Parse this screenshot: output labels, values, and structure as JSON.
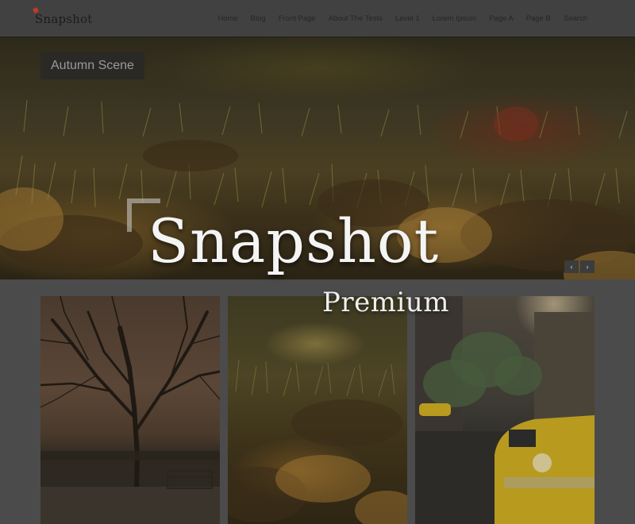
{
  "header": {
    "logo_text": "Snapshot",
    "nav": [
      {
        "label": "Home"
      },
      {
        "label": "Blog"
      },
      {
        "label": "Front Page"
      },
      {
        "label": "About The Tests"
      },
      {
        "label": "Level 1"
      },
      {
        "label": "Lorem Ipsum"
      },
      {
        "label": "Page A"
      },
      {
        "label": "Page B"
      },
      {
        "label": "Search"
      }
    ]
  },
  "slider": {
    "caption": "Autumn Scene",
    "prev_icon": "‹",
    "next_icon": "›"
  },
  "branding": {
    "title": "Snapshot",
    "subtitle": "Premium"
  },
  "colors": {
    "header_bg": "#414141",
    "page_bg": "#4b4b4b",
    "logo_accent": "#c0392b"
  }
}
